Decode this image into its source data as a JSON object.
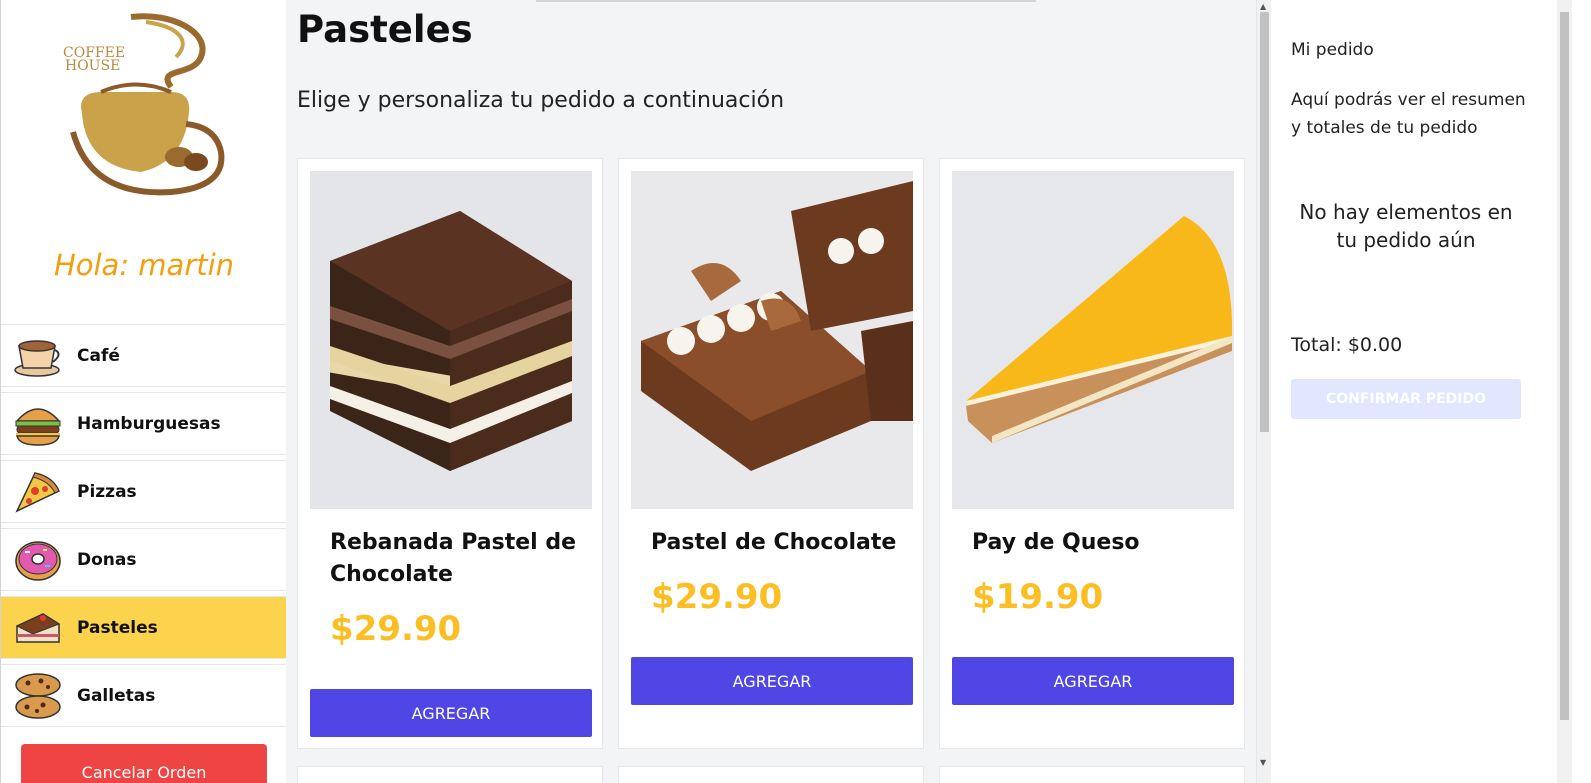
{
  "sidebar": {
    "logo_text_line1": "COFFEE",
    "logo_text_line2": "HOUSE",
    "greeting": "Hola: martin",
    "categories": [
      {
        "label": "Café",
        "icon": "coffee-cup-icon"
      },
      {
        "label": "Hamburguesas",
        "icon": "burger-icon"
      },
      {
        "label": "Pizzas",
        "icon": "pizza-slice-icon"
      },
      {
        "label": "Donas",
        "icon": "donut-icon"
      },
      {
        "label": "Pasteles",
        "icon": "cake-slice-icon",
        "active": true
      },
      {
        "label": "Galletas",
        "icon": "cookies-icon"
      }
    ],
    "cancel_label": "Cancelar Orden"
  },
  "main": {
    "title": "Pasteles",
    "subtitle": "Elige y personaliza tu pedido a continuación",
    "products": [
      {
        "name": "Rebanada Pastel de Chocolate",
        "price": "$29.90",
        "button": "AGREGAR"
      },
      {
        "name": "Pastel de Chocolate",
        "price": "$29.90",
        "button": "AGREGAR"
      },
      {
        "name": "Pay de Queso",
        "price": "$19.90",
        "button": "AGREGAR"
      }
    ]
  },
  "order": {
    "title": "Mi pedido",
    "description": "Aquí podrás ver el resumen y totales de tu pedido",
    "empty_message": "No hay elementos en tu pedido aún",
    "total": "Total: $0.00",
    "confirm_label": "CONFIRMAR PEDIDO"
  },
  "colors": {
    "accent": "#4f46e5",
    "active_category": "#fcd34d",
    "price": "#fbbf24",
    "greeting": "#f59e0b",
    "cancel": "#ef4444"
  }
}
